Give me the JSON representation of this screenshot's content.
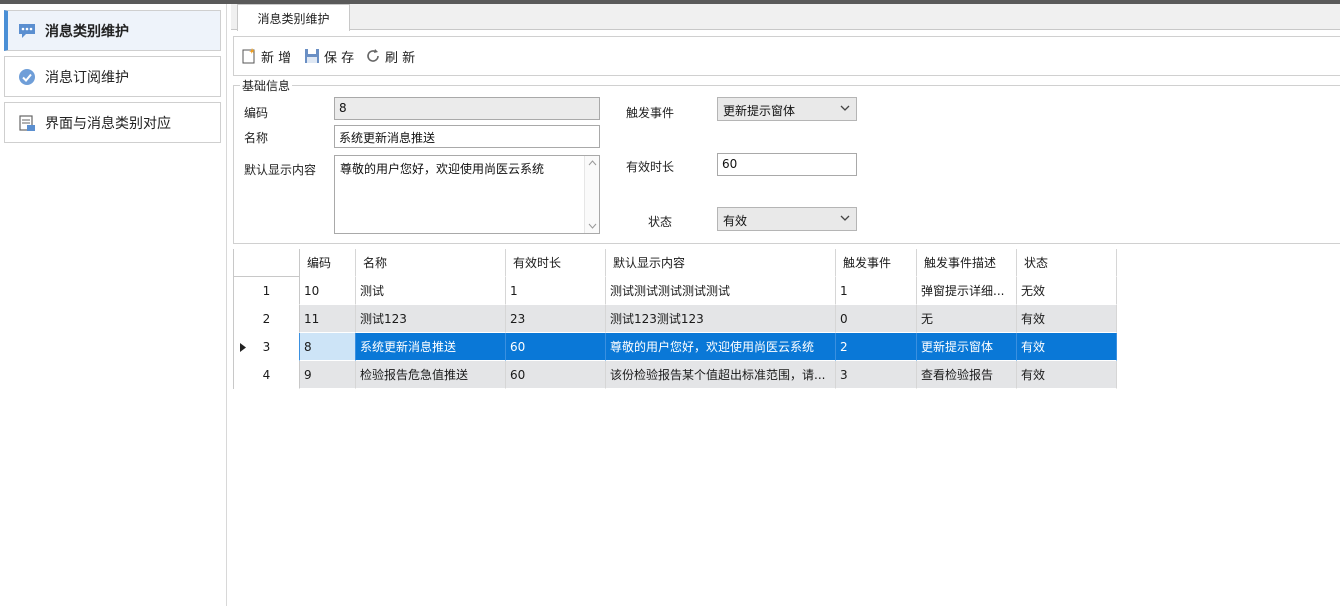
{
  "sidebar": {
    "items": [
      {
        "label": "消息类别维护",
        "icon": "chat-bubble-icon"
      },
      {
        "label": "消息订阅维护",
        "icon": "check-circle-icon"
      },
      {
        "label": "界面与消息类别对应",
        "icon": "window-message-icon"
      }
    ]
  },
  "tabs": [
    {
      "label": "消息类别维护"
    }
  ],
  "toolbar": {
    "new_label": "新 增",
    "save_label": "保 存",
    "refresh_label": "刷 新"
  },
  "form": {
    "group_title": "基础信息",
    "code_label": "编码",
    "code_value": "8",
    "name_label": "名称",
    "name_value": "系统更新消息推送",
    "content_label": "默认显示内容",
    "content_value": "尊敬的用户您好，欢迎使用尚医云系统",
    "event_label": "触发事件",
    "event_value": "更新提示窗体",
    "duration_label": "有效时长",
    "duration_value": "60",
    "status_label": "状态",
    "status_value": "有效"
  },
  "grid": {
    "headers": [
      "编码",
      "名称",
      "有效时长",
      "默认显示内容",
      "触发事件",
      "触发事件描述",
      "状态"
    ],
    "rows": [
      {
        "num": "1",
        "code": "10",
        "name": "测试",
        "duration": "1",
        "content": "测试测试测试测试测试",
        "event": "1",
        "event_desc": "弹窗提示详细...",
        "status": "无效"
      },
      {
        "num": "2",
        "code": "11",
        "name": "测试123",
        "duration": "23",
        "content": "测试123测试123",
        "event": "0",
        "event_desc": "无",
        "status": "有效"
      },
      {
        "num": "3",
        "code": "8",
        "name": "系统更新消息推送",
        "duration": "60",
        "content": "尊敬的用户您好，欢迎使用尚医云系统",
        "event": "2",
        "event_desc": "更新提示窗体",
        "status": "有效"
      },
      {
        "num": "4",
        "code": "9",
        "name": "检验报告危急值推送",
        "duration": "60",
        "content": "该份检验报告某个值超出标准范围，请...",
        "event": "3",
        "event_desc": "查看检验报告",
        "status": "有效"
      }
    ]
  },
  "colors": {
    "selected_row": "#0a78d7",
    "accent": "#4a8fd6"
  }
}
